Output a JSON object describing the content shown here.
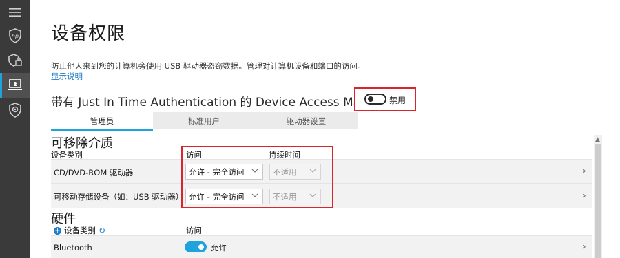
{
  "sidebar": {
    "items": [
      {
        "icon": "hamburger-menu-icon"
      },
      {
        "icon": "hp-shield-icon"
      },
      {
        "icon": "secure-browser-icon"
      },
      {
        "icon": "device-access-icon",
        "active": true
      },
      {
        "icon": "gear-shield-icon"
      }
    ]
  },
  "page": {
    "title": "设备权限",
    "description": "防止他人来到您的计算机旁使用 USB 驱动器盗窃数据。管理对计算机设备和端口的访问。",
    "more_link": "显示说明",
    "jit_label": "带有 Just In Time Authentication 的 Device Access Manager",
    "jit_toggle_label": "禁用"
  },
  "tabs": [
    {
      "label": "管理员",
      "active": true
    },
    {
      "label": "标准用户",
      "active": false
    },
    {
      "label": "驱动器设置",
      "active": false
    }
  ],
  "removable": {
    "title": "可移除介质",
    "col_category": "设备类别",
    "col_access": "访问",
    "col_duration": "持续时间",
    "rows": [
      {
        "label": "CD/DVD-ROM 驱动器",
        "access": "允许 - 完全访问",
        "duration": "不适用"
      },
      {
        "label": "可移动存储设备（如：USB 驱动器）",
        "access": "允许 - 完全访问",
        "duration": "不适用"
      }
    ]
  },
  "hardware": {
    "title": "硬件",
    "col_category": "设备类别",
    "col_access": "访问",
    "rows": [
      {
        "label": "Bluetooth",
        "access_label": "允许",
        "enabled": true
      }
    ]
  },
  "colors": {
    "accent": "#1fa3dd",
    "highlight_box": "#d9262e",
    "sidebar_bg": "#3a3a3a"
  }
}
